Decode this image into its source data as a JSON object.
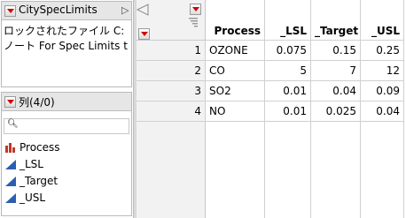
{
  "table_panel": {
    "title": "CitySpecLimits",
    "description_line1": "ロックされたファイル C:",
    "description_line2": "ノート For Spec Limits t"
  },
  "columns_panel": {
    "title": "列(4/0)",
    "search_placeholder": "",
    "items": [
      {
        "label": "Process",
        "icon": "nominal-bar-icon"
      },
      {
        "label": "_LSL",
        "icon": "continuous-triangle-icon"
      },
      {
        "label": "_Target",
        "icon": "continuous-triangle-icon"
      },
      {
        "label": "_USL",
        "icon": "continuous-triangle-icon"
      }
    ]
  },
  "grid": {
    "headers": [
      "Process",
      "_LSL",
      "_Target",
      "_USL"
    ],
    "rows": [
      {
        "n": "1",
        "cells": [
          "OZONE",
          "0.075",
          "0.15",
          "0.25"
        ]
      },
      {
        "n": "2",
        "cells": [
          "CO",
          "5",
          "7",
          "12"
        ]
      },
      {
        "n": "3",
        "cells": [
          "SO2",
          "0.01",
          "0.04",
          "0.09"
        ]
      },
      {
        "n": "4",
        "cells": [
          "NO",
          "0.01",
          "0.025",
          "0.04"
        ]
      }
    ]
  },
  "colors": {
    "accent_red": "#d00000",
    "continuous_blue": "#2a5fb0",
    "nominal_red": "#c0392b"
  }
}
